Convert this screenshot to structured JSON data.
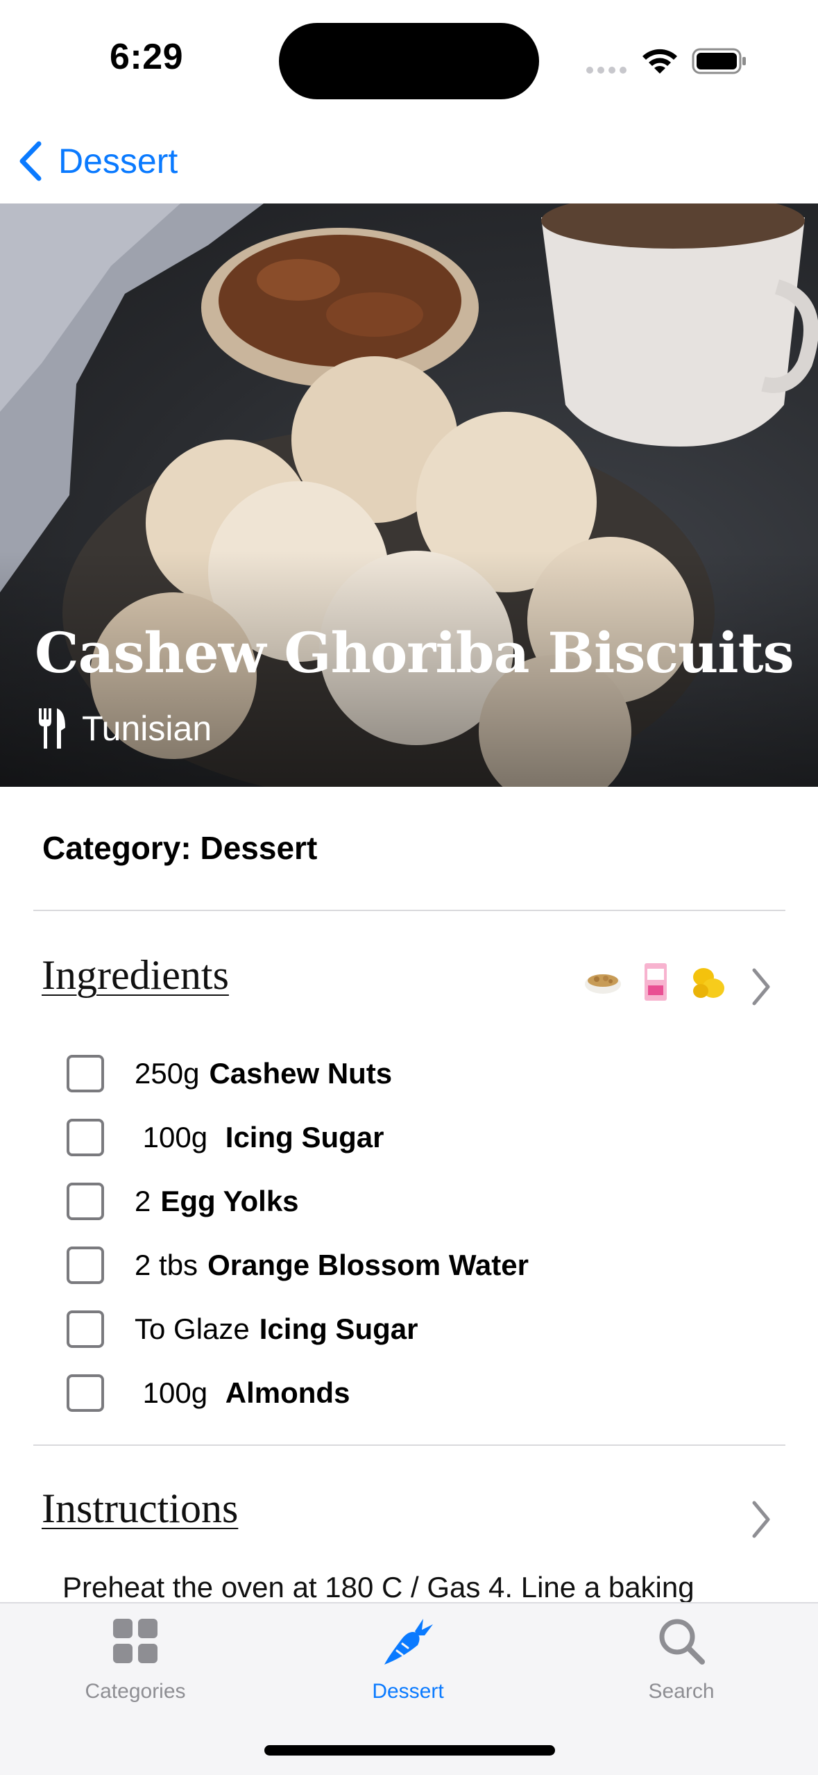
{
  "status_bar": {
    "time": "6:29"
  },
  "nav": {
    "back_label": "Dessert"
  },
  "meal": {
    "title": "Cashew Ghoriba Biscuits",
    "area": "Tunisian",
    "category_line": "Category: Dessert"
  },
  "ingredients": {
    "title": "Ingredients",
    "thumbnails": [
      "cashew-bowl-icon",
      "sugar-bag-icon",
      "lemon-icon"
    ],
    "items": [
      {
        "measure": "250g",
        "name": "Cashew Nuts",
        "checked": false
      },
      {
        "measure": " 100g ",
        "name": "Icing Sugar",
        "checked": false
      },
      {
        "measure": "2",
        "name": "Egg Yolks",
        "checked": false
      },
      {
        "measure": "2 tbs",
        "name": "Orange Blossom Water",
        "checked": false
      },
      {
        "measure": "To Glaze",
        "name": "Icing Sugar",
        "checked": false
      },
      {
        "measure": " 100g ",
        "name": "Almonds",
        "checked": false
      }
    ]
  },
  "instructions": {
    "title": "Instructions",
    "text": "Preheat the oven at 180 C / Gas 4. Line a baking"
  },
  "tab_bar": {
    "tabs": [
      {
        "label": "Categories",
        "icon": "grid-icon",
        "active": false
      },
      {
        "label": "Dessert",
        "icon": "carrot-icon",
        "active": true
      },
      {
        "label": "Search",
        "icon": "search-icon",
        "active": false
      }
    ]
  },
  "colors": {
    "accent": "#0a7aff",
    "inactive_tab": "#8e8e93"
  }
}
